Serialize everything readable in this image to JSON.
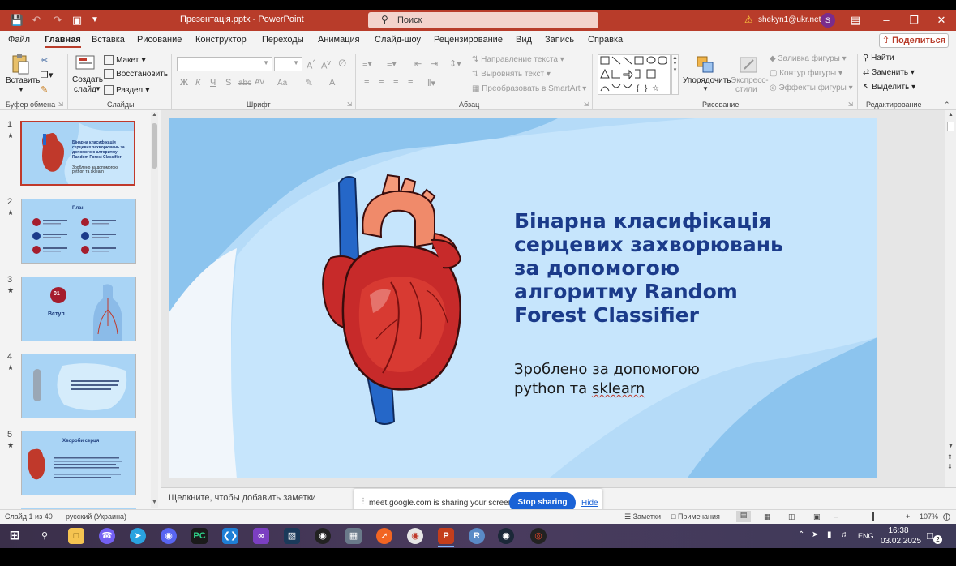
{
  "window": {
    "title": "Презентація.pptx  -  PowerPoint",
    "search_placeholder": "Поиск",
    "account": "shekyn1@ukr.net",
    "avatar_letter": "S"
  },
  "menu_tabs": [
    "Файл",
    "Главная",
    "Вставка",
    "Рисование",
    "Конструктор",
    "Переходы",
    "Анимация",
    "Слайд-шоу",
    "Рецензирование",
    "Вид",
    "Запись",
    "Справка"
  ],
  "active_tab": "Главная",
  "share_label": "Поделиться",
  "ribbon": {
    "clipboard": {
      "paste": "Вставить",
      "group": "Буфер обмена"
    },
    "slides": {
      "create": "Создать",
      "create2": "слайд",
      "layout": "Макет",
      "reset": "Восстановить",
      "section": "Раздел",
      "group": "Слайды"
    },
    "font": {
      "bold": "Ж",
      "italic": "К",
      "underline": "Ч",
      "strike": "S",
      "abc": "abc",
      "spacing": "AV",
      "case": "Aa",
      "group": "Шрифт"
    },
    "paragraph": {
      "text_direction": "Направление текста",
      "align_text": "Выровнять текст",
      "smartart": "Преобразовать в SmartArt",
      "group": "Абзац"
    },
    "drawing": {
      "arrange": "Упорядочить",
      "quick_styles": "Экспресс-",
      "quick_styles2": "стили",
      "fill": "Заливка фигуры",
      "outline": "Контур фигуры",
      "effects": "Эффекты фигуры",
      "group": "Рисование"
    },
    "editing": {
      "find": "Найти",
      "replace": "Заменить",
      "select": "Выделить",
      "group": "Редактирование"
    }
  },
  "thumbnails": [
    {
      "num": "1",
      "title": "Бінарна класифікація серцевих захворювань за допомогою алгоритму Random Forest Classifier",
      "sub": "Зроблено за допомогою python та sklearn"
    },
    {
      "num": "2",
      "title": "План"
    },
    {
      "num": "3",
      "badge": "01",
      "title": "Вступ"
    },
    {
      "num": "4"
    },
    {
      "num": "5",
      "title": "Хвороби серця"
    }
  ],
  "slide": {
    "title": "Бінарна класифікація\nсерцевих захворювань\nза допомогою\nалгоритму Random\nForest Classifier",
    "subtitle_line1": "Зроблено за допомогою",
    "subtitle_line2_a": "python та ",
    "subtitle_line2_b": "sklearn"
  },
  "notes_placeholder": "Щелкните, чтобы добавить заметки",
  "sharing": {
    "text": "meet.google.com is sharing your screen.",
    "stop": "Stop sharing",
    "hide": "Hide"
  },
  "status": {
    "slide_of": "Слайд 1 из 40",
    "language": "русский (Украина)",
    "notes": "Заметки",
    "comments": "Примечания",
    "zoom": "107%"
  },
  "taskbar": {
    "lang": "ENG",
    "time": "16:38",
    "date": "03.02.2025",
    "notif_count": "2"
  },
  "colors": {
    "accent": "#b83c2a",
    "slide_bg": "#c4e3fb",
    "slide_title": "#1b3b8a",
    "stop_btn": "#1a62d6"
  }
}
